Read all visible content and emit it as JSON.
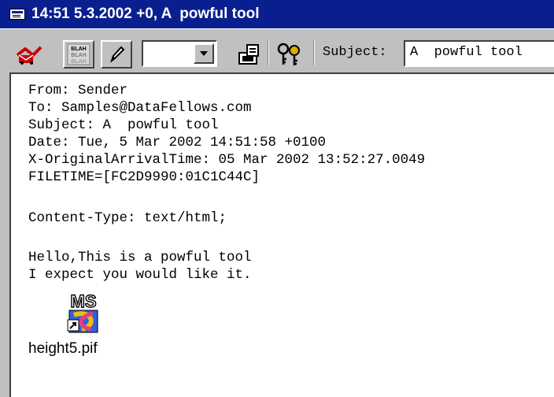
{
  "window": {
    "title": "14:51 5.3.2002 +0, A  powful tool"
  },
  "toolbar": {
    "buttons": [
      {
        "icon": "envelope-icon"
      },
      {
        "icon": "blah-stamp-icon",
        "text_lines": [
          "BLAH",
          "BLAH",
          "BLAH"
        ]
      },
      {
        "icon": "pencil-icon"
      },
      {
        "icon": "save-file-icon"
      },
      {
        "icon": "key-keys-icon"
      }
    ],
    "combo_value": "",
    "subject_label": "Subject:",
    "subject_value": "A  powful tool"
  },
  "message": {
    "headers": [
      "From: Sender",
      "To: Samples@DataFellows.com",
      "Subject: A  powful tool",
      "Date: Tue, 5 Mar 2002 14:51:58 +0100",
      "X-OriginalArrivalTime: 05 Mar 2002 13:52:27.0049",
      "FILETIME=[FC2D9990:01C1C44C]"
    ],
    "content_type": "Content-Type: text/html;",
    "body_lines": [
      "Hello,This is a powful tool",
      "I expect you would like it."
    ],
    "attachment": {
      "icon": "ms-dos-shortcut-icon",
      "icon_text": "MS",
      "filename": "height5.pif"
    }
  },
  "colors": {
    "titlebar": "#0a1f8f",
    "chrome": "#c0c0c0",
    "body": "#ffffff"
  }
}
